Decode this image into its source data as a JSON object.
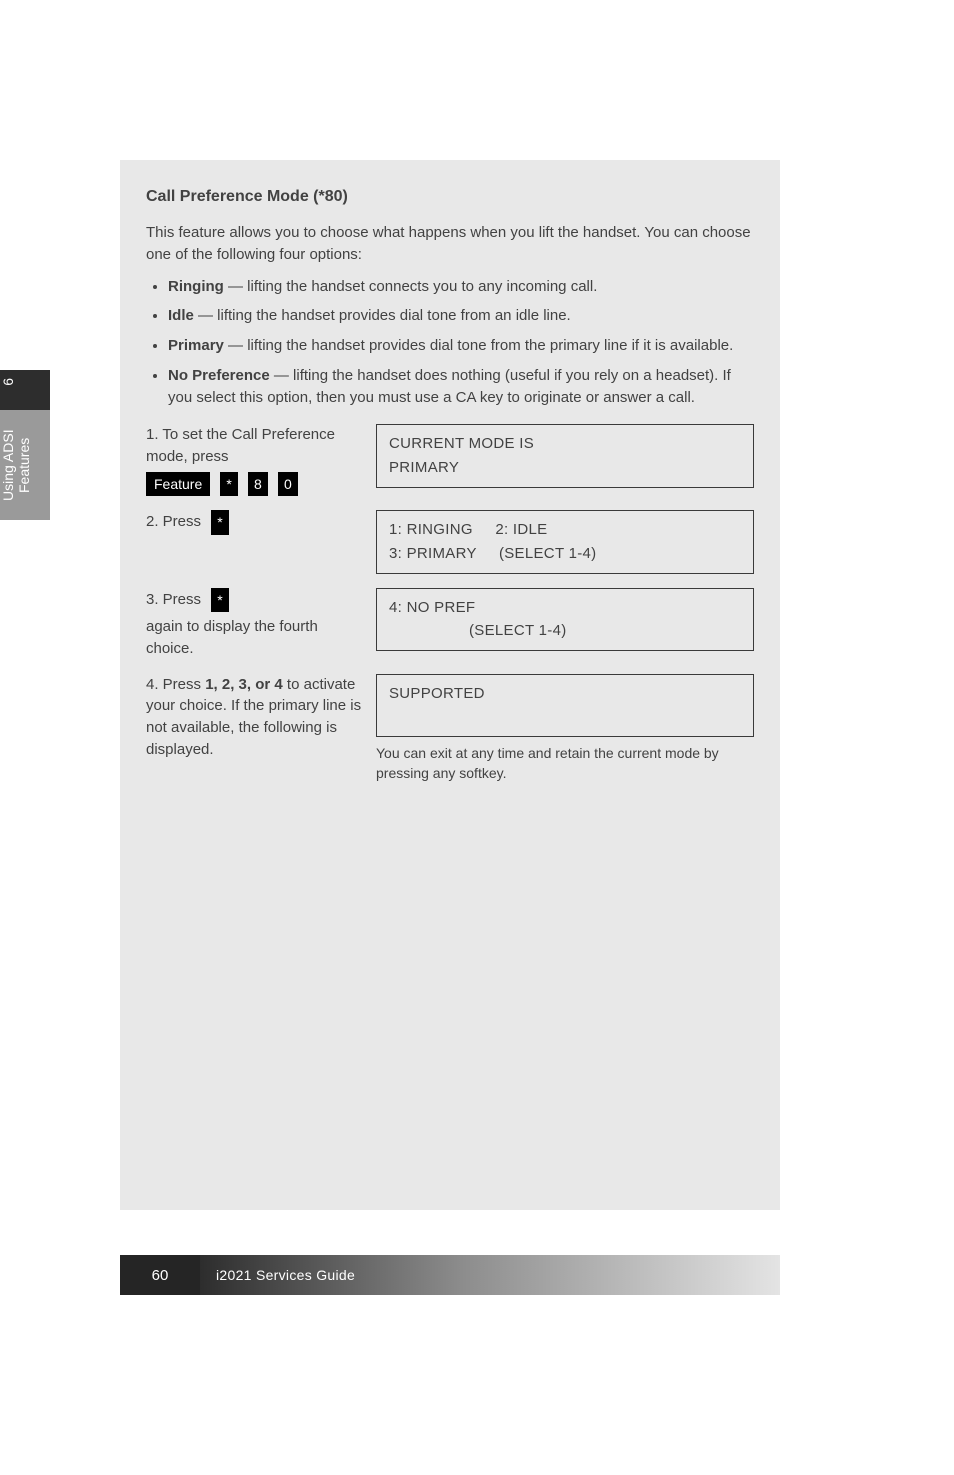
{
  "side": {
    "dark_label": "6",
    "light_label": "Using ADSI Features"
  },
  "section": {
    "heading": "Call Preference Mode (*80)",
    "intro": "This feature allows you to choose what happens when you lift the handset. You can choose one of the following four options:",
    "bullets": [
      {
        "label": "Ringing",
        "desc": " — lifting the handset connects you to any incoming call."
      },
      {
        "label": "Idle",
        "desc": " — lifting the handset provides dial tone from an idle line."
      },
      {
        "label": "Primary",
        "desc": " — lifting the handset provides dial tone from the primary line if it is available."
      },
      {
        "label": "No Preference",
        "desc": " — lifting the handset does nothing (useful if you rely on a headset). If you select this option, then you must use a CA key to originate or answer a call."
      }
    ]
  },
  "steps": {
    "s1": {
      "text": "1. To set the Call Preference mode, press",
      "keys": [
        "Feature",
        "*",
        "8",
        "0"
      ],
      "lcd_line1": "CURRENT MODE IS",
      "lcd_line2": "PRIMARY"
    },
    "s2": {
      "text": "2. Press",
      "keys": [
        "*"
      ],
      "lcd_line1a": "1: RINGING",
      "lcd_line1b": "2: IDLE",
      "lcd_line2a": "3: PRIMARY",
      "lcd_line2b": "(SELECT 1-4)"
    },
    "s3": {
      "text": "3. Press",
      "keys": [
        "*"
      ],
      "note_a": "again to display the fourth choice.",
      "lcd_line1": "4: NO PREF",
      "lcd_line2": "(SELECT 1-4)"
    },
    "s4": {
      "text_a": "4. Press",
      "text_b": "1, 2, 3, or 4",
      "text_c": " to activate your choice. If the primary line is not available, the following is displayed.",
      "lcd_line1": "SUPPORTED",
      "footnote": "You can exit at any time and retain the current mode by pressing any softkey."
    }
  },
  "footer": {
    "page": "60",
    "title": "i2021 Services Guide"
  }
}
